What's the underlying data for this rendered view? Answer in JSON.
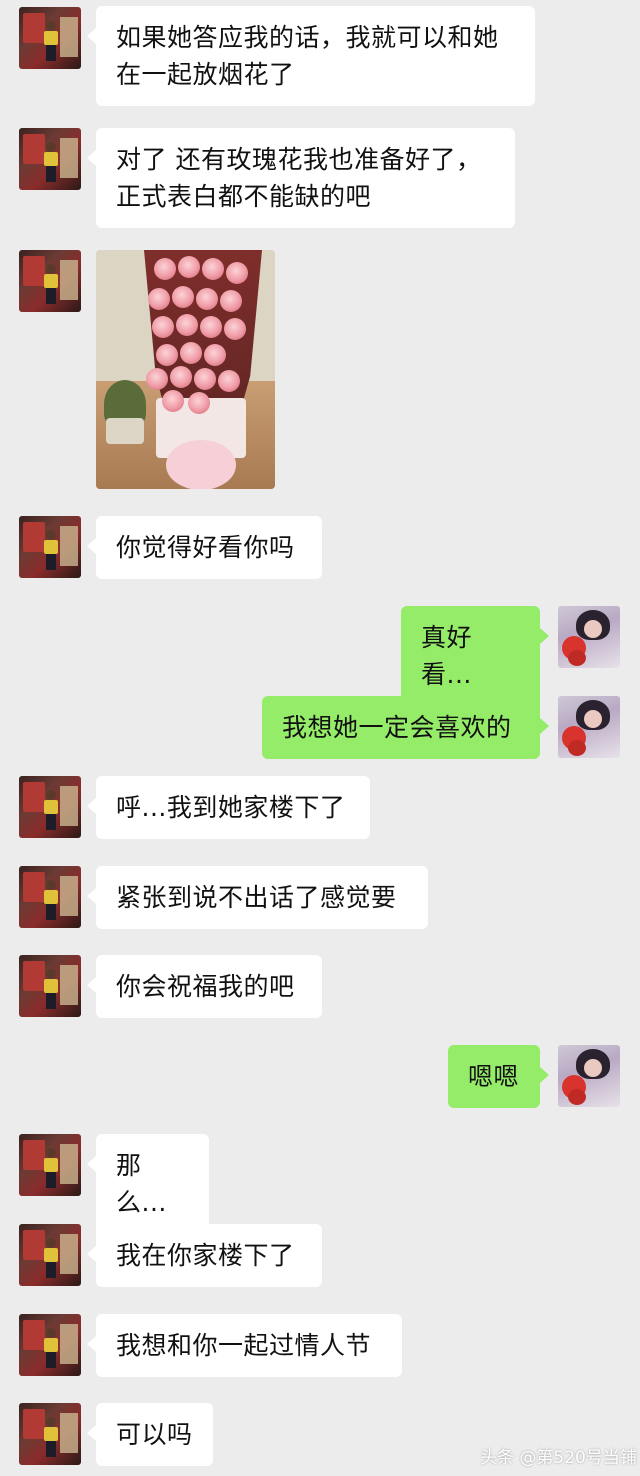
{
  "messages": [
    {
      "side": "in",
      "text": "如果她答应我的话，我就可以和她\n在一起放烟花了"
    },
    {
      "side": "in",
      "text": "对了 还有玫瑰花我也准备好了，\n正式表白都不能缺的吧"
    },
    {
      "side": "in",
      "image": "rose-bouquet-photo"
    },
    {
      "side": "in",
      "text": "你觉得好看你吗"
    },
    {
      "side": "out",
      "text": "真好看..."
    },
    {
      "side": "out",
      "text": "我想她一定会喜欢的"
    },
    {
      "side": "in",
      "text": "呼...我到她家楼下了"
    },
    {
      "side": "in",
      "text": "紧张到说不出话了感觉要"
    },
    {
      "side": "in",
      "text": "你会祝福我的吧"
    },
    {
      "side": "out",
      "text": "嗯嗯"
    },
    {
      "side": "in",
      "text": "那么..."
    },
    {
      "side": "in",
      "text": "我在你家楼下了"
    },
    {
      "side": "in",
      "text": "我想和你一起过情人节"
    },
    {
      "side": "in",
      "text": "可以吗"
    }
  ],
  "watermark": "头条 @第520号当铺",
  "colors": {
    "background": "#ececec",
    "incoming": "#ffffff",
    "outgoing": "#95ec69"
  }
}
